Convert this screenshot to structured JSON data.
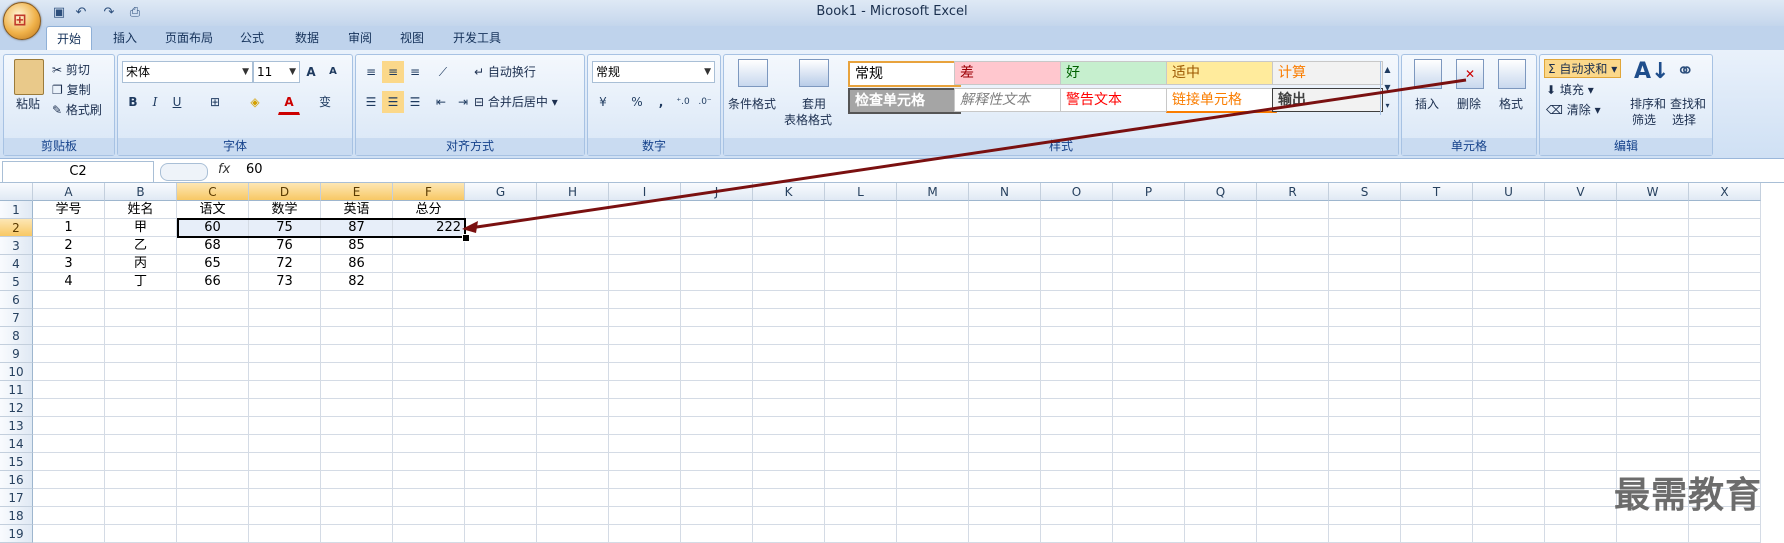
{
  "window": {
    "title": "Book1 - Microsoft Excel"
  },
  "tabs": [
    "开始",
    "插入",
    "页面布局",
    "公式",
    "数据",
    "审阅",
    "视图",
    "开发工具"
  ],
  "ribbon": {
    "clipboard": {
      "label": "剪贴板",
      "paste": "粘贴",
      "cut": "剪切",
      "copy": "复制",
      "format_painter": "格式刷"
    },
    "font": {
      "label": "字体",
      "name": "宋体",
      "size": "11",
      "grow": "A",
      "shrink": "A",
      "bold": "B",
      "italic": "I",
      "underline": "U",
      "font_color": "A",
      "phonetic": "变"
    },
    "alignment": {
      "label": "对齐方式",
      "wrap": "自动换行",
      "merge": "合并后居中"
    },
    "number": {
      "label": "数字",
      "format": "常规",
      "percent": "%",
      "comma": ","
    },
    "styles": {
      "label": "样式",
      "conditional": "条件格式",
      "table_top": "套用",
      "table_bottom": "表格格式",
      "cells": [
        {
          "text": "常规",
          "bg": "#ffffff",
          "fg": "#000000"
        },
        {
          "text": "差",
          "bg": "#ffc7ce",
          "fg": "#9c0006"
        },
        {
          "text": "好",
          "bg": "#c6efce",
          "fg": "#006100"
        },
        {
          "text": "适中",
          "bg": "#ffeb9c",
          "fg": "#9c5700"
        },
        {
          "text": "计算",
          "bg": "#f2f2f2",
          "fg": "#fa7d00"
        },
        {
          "text": "检查单元格",
          "bg": "#a5a5a5",
          "fg": "#ffffff"
        },
        {
          "text": "解释性文本",
          "bg": "#ffffff",
          "fg": "#7f7f7f"
        },
        {
          "text": "警告文本",
          "bg": "#ffffff",
          "fg": "#ff0000"
        },
        {
          "text": "链接单元格",
          "bg": "#ffffff",
          "fg": "#fa7d00"
        },
        {
          "text": "输出",
          "bg": "#f2f2f2",
          "fg": "#3f3f3f"
        }
      ]
    },
    "cells": {
      "label": "单元格",
      "insert": "插入",
      "delete": "删除",
      "format": "格式"
    },
    "editing": {
      "label": "编辑",
      "autosum": "自动求和",
      "fill": "填充",
      "clear": "清除",
      "sort_top": "排序和",
      "sort_bottom": "筛选",
      "find_top": "查找和",
      "find_bottom": "选择"
    }
  },
  "formula_bar": {
    "name_box": "C2",
    "fx": "fx",
    "value": "60"
  },
  "sheet": {
    "columns": [
      "A",
      "B",
      "C",
      "D",
      "E",
      "F",
      "G",
      "H",
      "I",
      "J",
      "K",
      "L",
      "M",
      "N",
      "O",
      "P",
      "Q",
      "R",
      "S",
      "T",
      "U",
      "V",
      "W",
      "X"
    ],
    "row_numbers": [
      "1",
      "2",
      "3",
      "4",
      "5",
      "6",
      "7",
      "8",
      "9",
      "10",
      "11",
      "12",
      "13",
      "14",
      "15",
      "16",
      "17",
      "18",
      "19"
    ],
    "data": [
      [
        "学号",
        "姓名",
        "语文",
        "数学",
        "英语",
        "总分"
      ],
      [
        "1",
        "甲",
        "60",
        "75",
        "87",
        "222"
      ],
      [
        "2",
        "乙",
        "68",
        "76",
        "85",
        ""
      ],
      [
        "3",
        "丙",
        "65",
        "72",
        "86",
        ""
      ],
      [
        "4",
        "丁",
        "66",
        "73",
        "82",
        ""
      ]
    ]
  },
  "watermark": "最需教育"
}
